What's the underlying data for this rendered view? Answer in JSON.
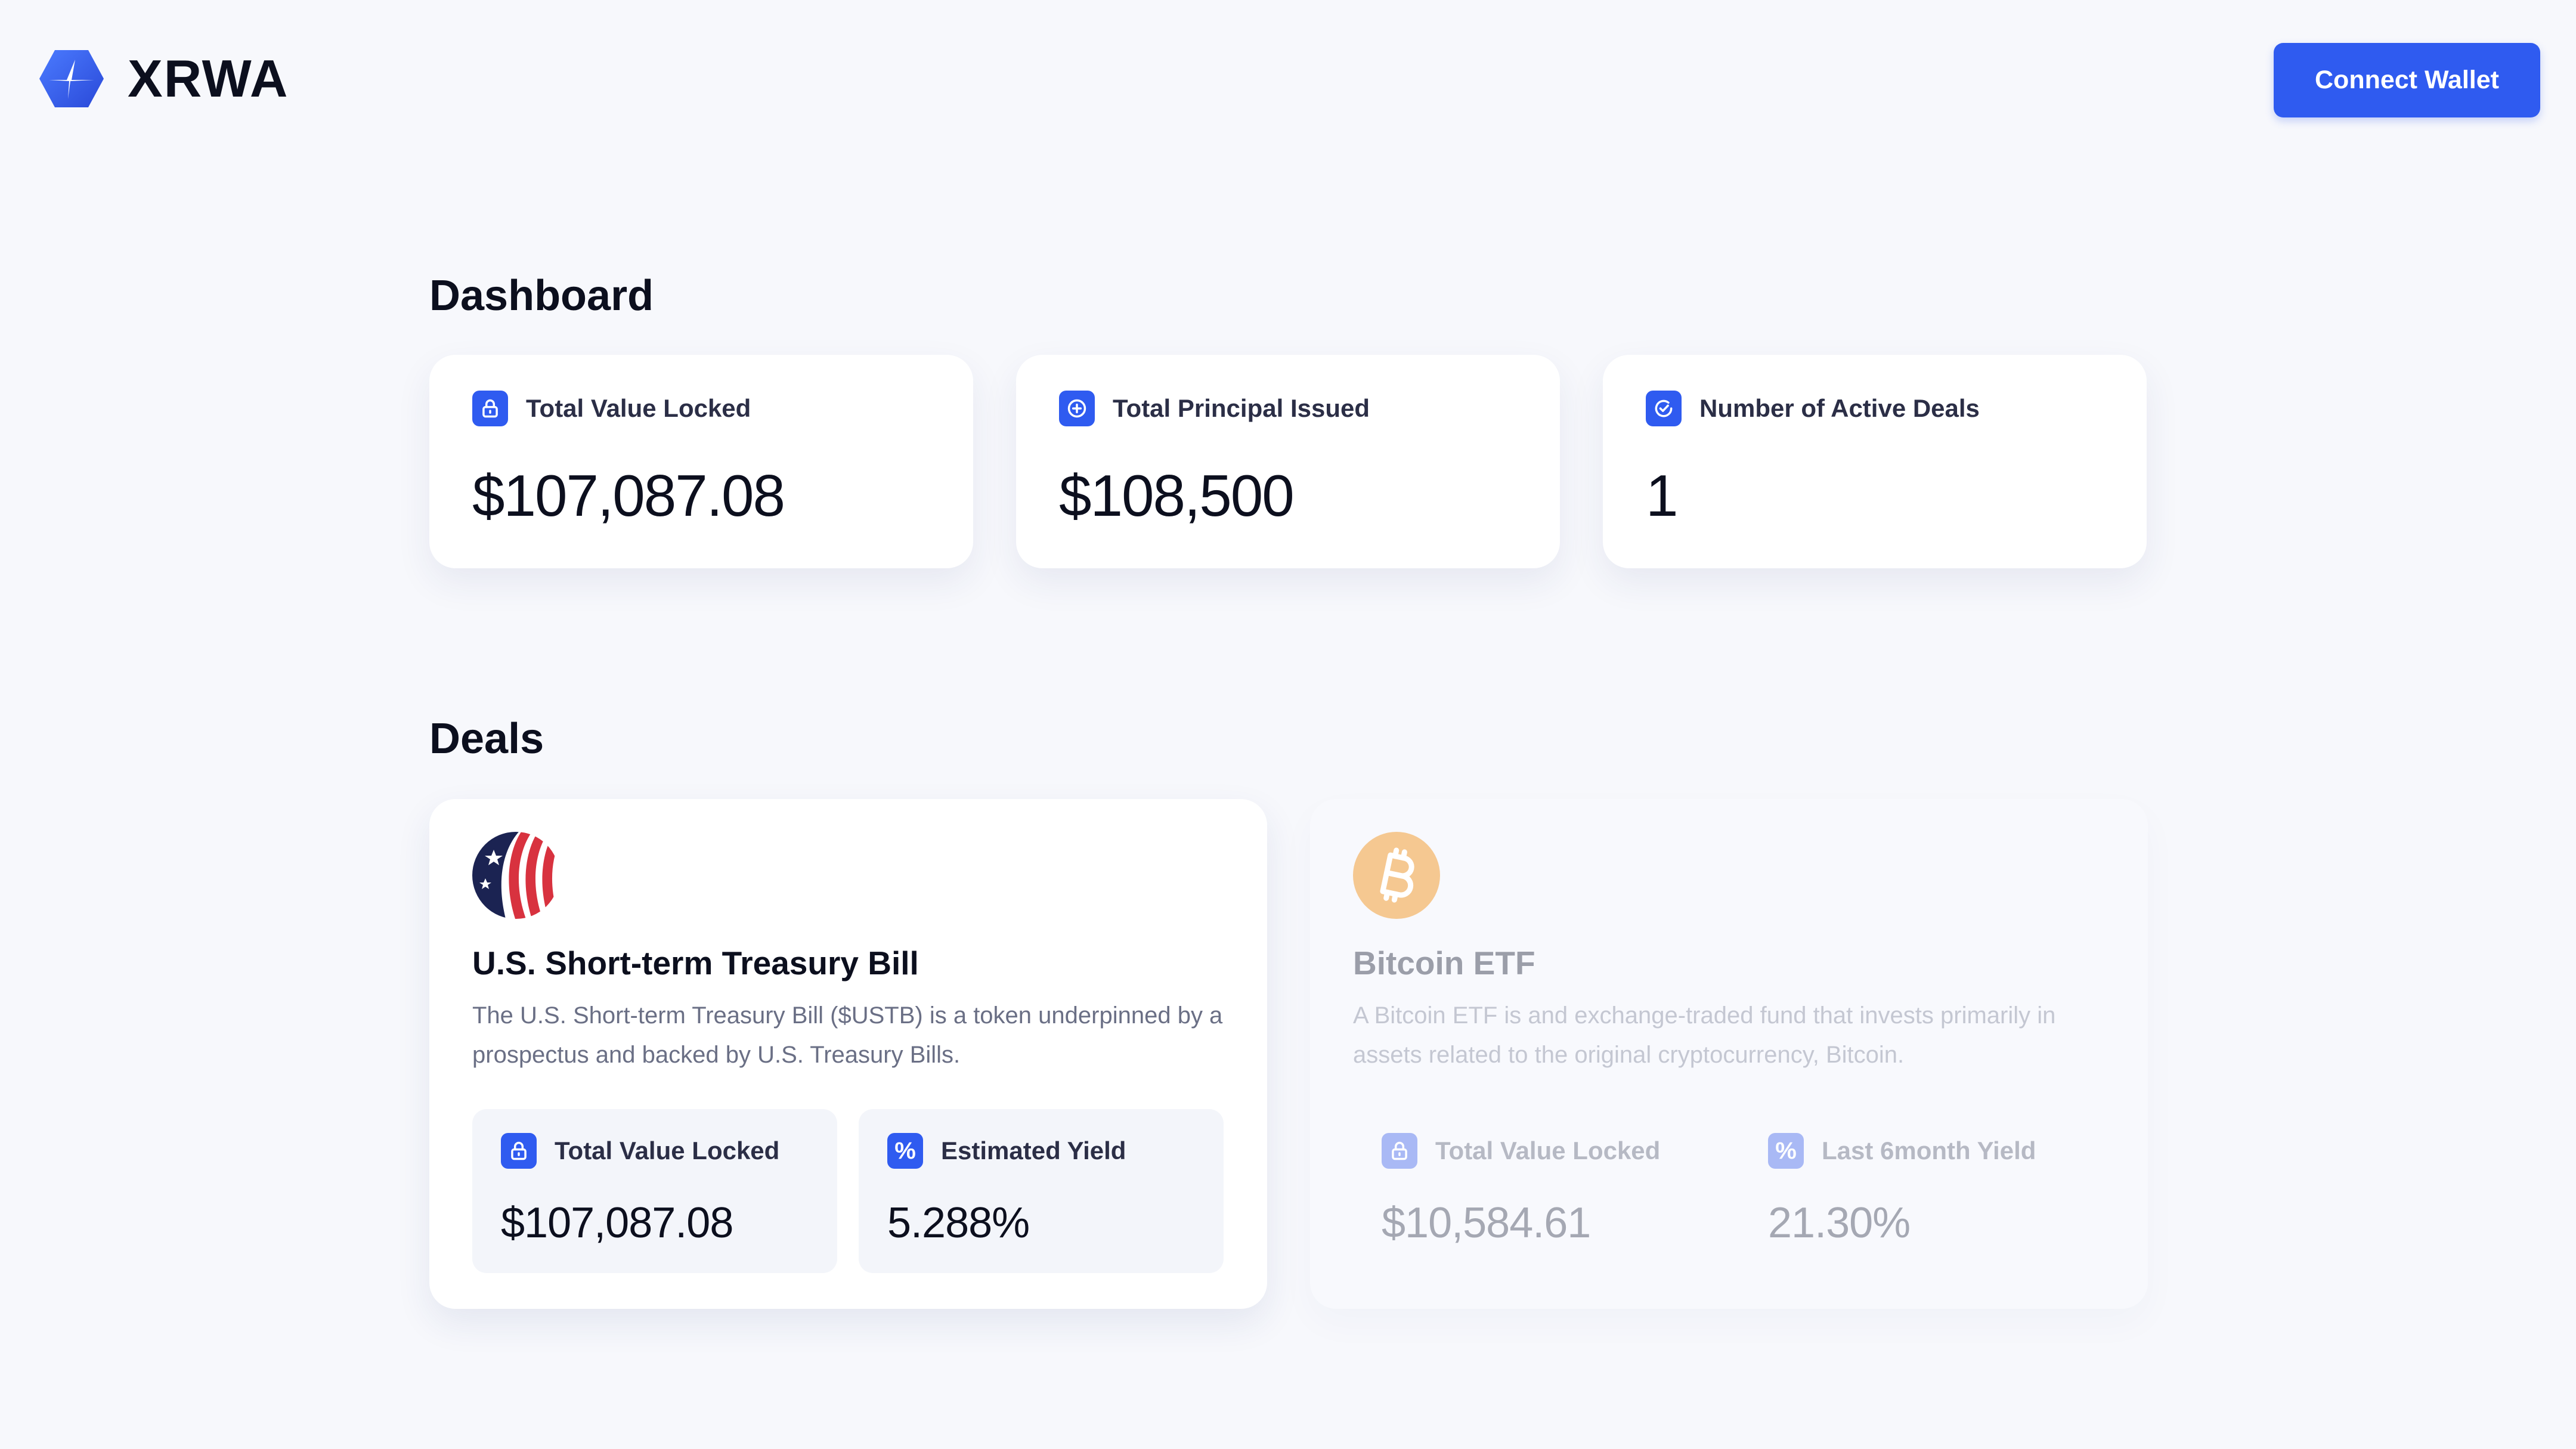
{
  "app": {
    "brand": "XRWA",
    "connect_label": "Connect Wallet",
    "accent_color": "#2f5bf0"
  },
  "dashboard": {
    "title": "Dashboard",
    "stats": [
      {
        "icon": "lock-icon",
        "label": "Total Value Locked",
        "value": "$107,087.08"
      },
      {
        "icon": "plus-circle-icon",
        "label": "Total Principal Issued",
        "value": "$108,500"
      },
      {
        "icon": "check-badge-icon",
        "label": "Number of Active Deals",
        "value": "1"
      }
    ]
  },
  "deals": {
    "title": "Deals",
    "items": [
      {
        "icon": "us-flag-icon",
        "name": "U.S. Short-term Treasury Bill",
        "description": "The U.S. Short-term Treasury Bill ($USTB) is a token underpinned by a prospectus and backed by U.S. Treasury Bills.",
        "metrics": [
          {
            "icon": "lock-icon",
            "label": "Total Value Locked",
            "value": "$107,087.08"
          },
          {
            "icon": "percent-icon",
            "label": "Estimated Yield",
            "value": "5.288%"
          }
        ]
      },
      {
        "icon": "bitcoin-icon",
        "name": "Bitcoin ETF",
        "description": "A Bitcoin ETF is and exchange-traded fund that invests primarily in assets related to the original cryptocurrency, Bitcoin.",
        "status": "disabled",
        "metrics": [
          {
            "icon": "lock-icon",
            "label": "Total Value Locked",
            "value": "$10,584.61"
          },
          {
            "icon": "percent-icon",
            "label": "Last 6month Yield",
            "value": "21.30%"
          }
        ]
      }
    ]
  }
}
